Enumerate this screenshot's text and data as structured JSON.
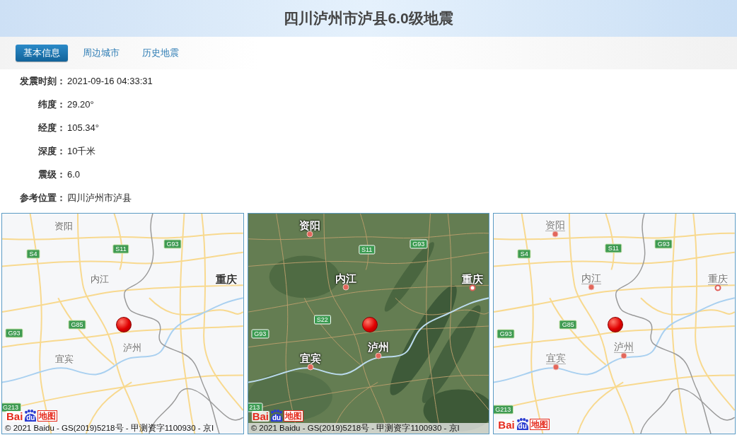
{
  "header": {
    "title": "四川泸州市泸县6.0级地震"
  },
  "tabs": [
    {
      "label": "基本信息",
      "selected": true
    },
    {
      "label": "周边城市",
      "selected": false
    },
    {
      "label": "历史地震",
      "selected": false
    }
  ],
  "details": [
    {
      "label": "发震时刻：",
      "value": "2021-09-16 04:33:31"
    },
    {
      "label": "纬度：",
      "value": "29.20°"
    },
    {
      "label": "经度：",
      "value": "105.34°"
    },
    {
      "label": "深度：",
      "value": "10千米"
    },
    {
      "label": "震级：",
      "value": "6.0"
    },
    {
      "label": "参考位置：",
      "value": "四川泸州市泸县"
    }
  ],
  "maps": [
    {
      "kind": "road",
      "cities": [
        {
          "name": "资阳",
          "capital": false
        },
        {
          "name": "内江",
          "capital": false
        },
        {
          "name": "重庆",
          "capital": true
        },
        {
          "name": "泸州",
          "capital": false
        },
        {
          "name": "宜宾",
          "capital": false
        }
      ],
      "highways": [
        "S4",
        "S11",
        "G93",
        "G85",
        "G93",
        "G213"
      ],
      "logo": [
        "Bai",
        "du",
        "地图"
      ],
      "copyright": "© 2021 Baidu - GS(2019)5218号 - 甲测资字1100930 - 京I"
    },
    {
      "kind": "satellite",
      "cities": [
        {
          "name": "资阳",
          "capital": false
        },
        {
          "name": "内江",
          "capital": false
        },
        {
          "name": "重庆",
          "capital": true
        },
        {
          "name": "泸州",
          "capital": false
        },
        {
          "name": "宜宾",
          "capital": false
        }
      ],
      "highways": [
        "S11",
        "G93",
        "S22",
        "G93",
        "213"
      ],
      "logo": [
        "Bai",
        "du",
        "地图"
      ],
      "copyright": "© 2021 Baidu - GS(2019)5218号 - 甲测资字1100930 - 京I"
    },
    {
      "kind": "pinned",
      "cities": [
        {
          "name": "资阳",
          "capital": false
        },
        {
          "name": "内江",
          "capital": false
        },
        {
          "name": "重庆",
          "capital": true
        },
        {
          "name": "泸州",
          "capital": false
        },
        {
          "name": "宜宾",
          "capital": false
        }
      ],
      "highways": [
        "S4",
        "S11",
        "G93",
        "G85",
        "G93",
        "G213"
      ],
      "logo": [
        "Bai",
        "du",
        "地图"
      ]
    }
  ]
}
